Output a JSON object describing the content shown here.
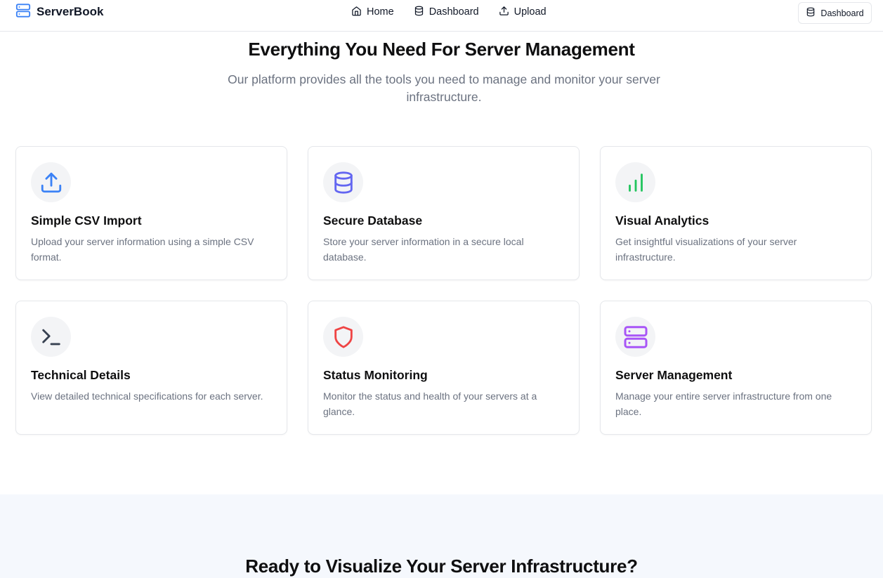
{
  "brand": {
    "name": "ServerBook",
    "icon": "server-icon",
    "color": "#3b82f6"
  },
  "nav": {
    "links": [
      {
        "label": "Home",
        "icon": "home-icon"
      },
      {
        "label": "Dashboard",
        "icon": "database-icon"
      },
      {
        "label": "Upload",
        "icon": "upload-icon"
      }
    ],
    "button_label": "Dashboard"
  },
  "features": {
    "title": "Everything You Need For Server Management",
    "subtitle": "Our platform provides all the tools you need to manage and monitor your server infrastructure.",
    "cards": [
      {
        "title": "Simple CSV Import",
        "description": "Upload your server information using a simple CSV format.",
        "icon": "upload-icon",
        "icon_color": "#3b82f6"
      },
      {
        "title": "Secure Database",
        "description": "Store your server information in a secure local database.",
        "icon": "database-icon",
        "icon_color": "#6366f1"
      },
      {
        "title": "Visual Analytics",
        "description": "Get insightful visualizations of your server infrastructure.",
        "icon": "bar-chart-icon",
        "icon_color": "#22c55e"
      },
      {
        "title": "Technical Details",
        "description": "View detailed technical specifications for each server.",
        "icon": "terminal-icon",
        "icon_color": "#374151"
      },
      {
        "title": "Status Monitoring",
        "description": "Monitor the status and health of your servers at a glance.",
        "icon": "shield-icon",
        "icon_color": "#ef4444"
      },
      {
        "title": "Server Management",
        "description": "Manage your entire server infrastructure from one place.",
        "icon": "server-icon",
        "icon_color": "#a855f7"
      }
    ]
  },
  "cta": {
    "title": "Ready to Visualize Your Server Infrastructure?"
  }
}
